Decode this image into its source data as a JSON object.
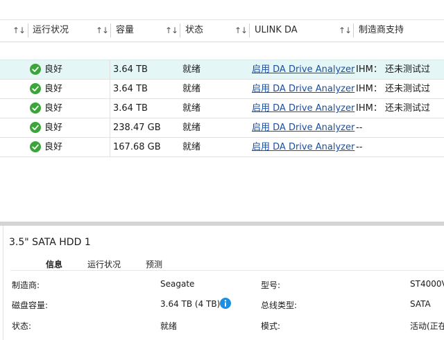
{
  "table": {
    "columns": [
      {
        "label": "",
        "sort_icon": "sort-arrows-icon"
      },
      {
        "label": "运行状况",
        "sort_icon": "sort-arrows-icon"
      },
      {
        "label": "容量",
        "sort_icon": "sort-arrows-icon"
      },
      {
        "label": "状态",
        "sort_icon": "sort-arrows-icon"
      },
      {
        "label": "ULINK DA",
        "sort_icon": "sort-arrows-icon"
      },
      {
        "label": "制造商支持"
      }
    ],
    "sort_glyph": "↑↓",
    "rows": [
      {
        "health": "良好",
        "capacity": "3.64 TB",
        "status": "就绪",
        "ulink": "启用 DA Drive Analyzer",
        "support": "IHM： 还未测试过",
        "selected": true
      },
      {
        "health": "良好",
        "capacity": "3.64 TB",
        "status": "就绪",
        "ulink": "启用 DA Drive Analyzer",
        "support": "IHM： 还未测试过",
        "selected": false
      },
      {
        "health": "良好",
        "capacity": "3.64 TB",
        "status": "就绪",
        "ulink": "启用 DA Drive Analyzer",
        "support": "IHM： 还未测试过",
        "selected": false
      },
      {
        "health": "良好",
        "capacity": "238.47 GB",
        "status": "就绪",
        "ulink": "启用 DA Drive Analyzer",
        "support": "--",
        "selected": false
      },
      {
        "health": "良好",
        "capacity": "167.68 GB",
        "status": "就绪",
        "ulink": "启用 DA Drive Analyzer",
        "support": "--",
        "selected": false
      }
    ],
    "health_icon": "check-circle-icon",
    "health_color": "#3aa63a"
  },
  "detail": {
    "title": "3.5\" SATA HDD 1",
    "tabs": [
      {
        "label": "信息",
        "active": true
      },
      {
        "label": "运行状况",
        "active": false
      },
      {
        "label": "预测",
        "active": false
      }
    ],
    "properties": {
      "manufacturer_label": "制造商:",
      "manufacturer_value": "Seagate",
      "model_label": "型号:",
      "model_value": "ST4000V",
      "capacity_label": "磁盘容量:",
      "capacity_value": "3.64 TB (4 TB)",
      "bus_label": "总线类型:",
      "bus_value": "SATA",
      "status_label": "状态:",
      "status_value": "就绪",
      "mode_label": "模式:",
      "mode_value": "活动(正在"
    },
    "info_icon": "info-icon",
    "info_color": "#1a8fe3"
  },
  "colors": {
    "selected_row": "#e5f6f6",
    "link": "#1a4fa3",
    "splitter": "#d4d4d4"
  }
}
